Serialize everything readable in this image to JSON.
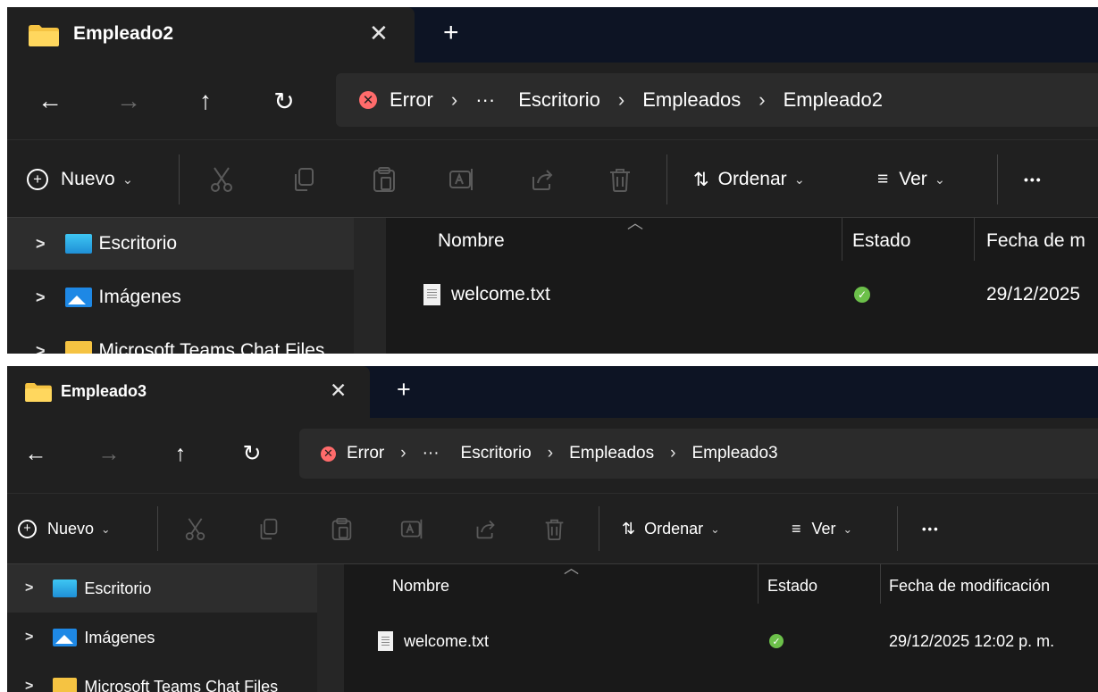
{
  "windows": [
    {
      "tab": {
        "title": "Empleado2",
        "close": "✕",
        "add": "+"
      },
      "nav": {
        "back": "←",
        "forward": "→",
        "up": "↑",
        "refresh": "↻"
      },
      "address": {
        "error_label": "Error",
        "ellipsis": "···",
        "crumbs": [
          "Escritorio",
          "Empleados",
          "Empleado2"
        ],
        "sep": "›"
      },
      "toolbar": {
        "new_label": "Nuevo",
        "sort_label": "Ordenar",
        "view_label": "Ver",
        "more": "•••"
      },
      "sidebar": [
        {
          "label": "Escritorio",
          "icon": "desktop-icon",
          "selected": true
        },
        {
          "label": "Imágenes",
          "icon": "pictures-icon",
          "selected": false
        },
        {
          "label": "Microsoft Teams Chat Files",
          "icon": "folder-icon",
          "selected": false
        }
      ],
      "columns": [
        "Nombre",
        "Estado",
        "Fecha de m"
      ],
      "files": [
        {
          "name": "welcome.txt",
          "status": "✓",
          "date": "29/12/2025"
        }
      ]
    },
    {
      "tab": {
        "title": "Empleado3",
        "close": "✕",
        "add": "+"
      },
      "nav": {
        "back": "←",
        "forward": "→",
        "up": "↑",
        "refresh": "↻"
      },
      "address": {
        "error_label": "Error",
        "ellipsis": "···",
        "crumbs": [
          "Escritorio",
          "Empleados",
          "Empleado3"
        ],
        "sep": "›"
      },
      "toolbar": {
        "new_label": "Nuevo",
        "sort_label": "Ordenar",
        "view_label": "Ver",
        "more": "•••"
      },
      "sidebar": [
        {
          "label": "Escritorio",
          "icon": "desktop-icon",
          "selected": true
        },
        {
          "label": "Imágenes",
          "icon": "pictures-icon",
          "selected": false
        },
        {
          "label": "Microsoft Teams Chat Files",
          "icon": "folder-icon",
          "selected": false
        }
      ],
      "columns": [
        "Nombre",
        "Estado",
        "Fecha de modificación"
      ],
      "files": [
        {
          "name": "welcome.txt",
          "status": "✓",
          "date": "29/12/2025 12:02 p. m."
        }
      ]
    }
  ],
  "colors": {
    "window_bg": "#191919",
    "tabstrip_bg": "#0d1424",
    "chrome_bg": "#202020",
    "address_bg": "#2b2b2b",
    "error_red": "#ff6b6b",
    "ok_green": "#6cc04a",
    "folder_yellow": "#f5c342"
  }
}
